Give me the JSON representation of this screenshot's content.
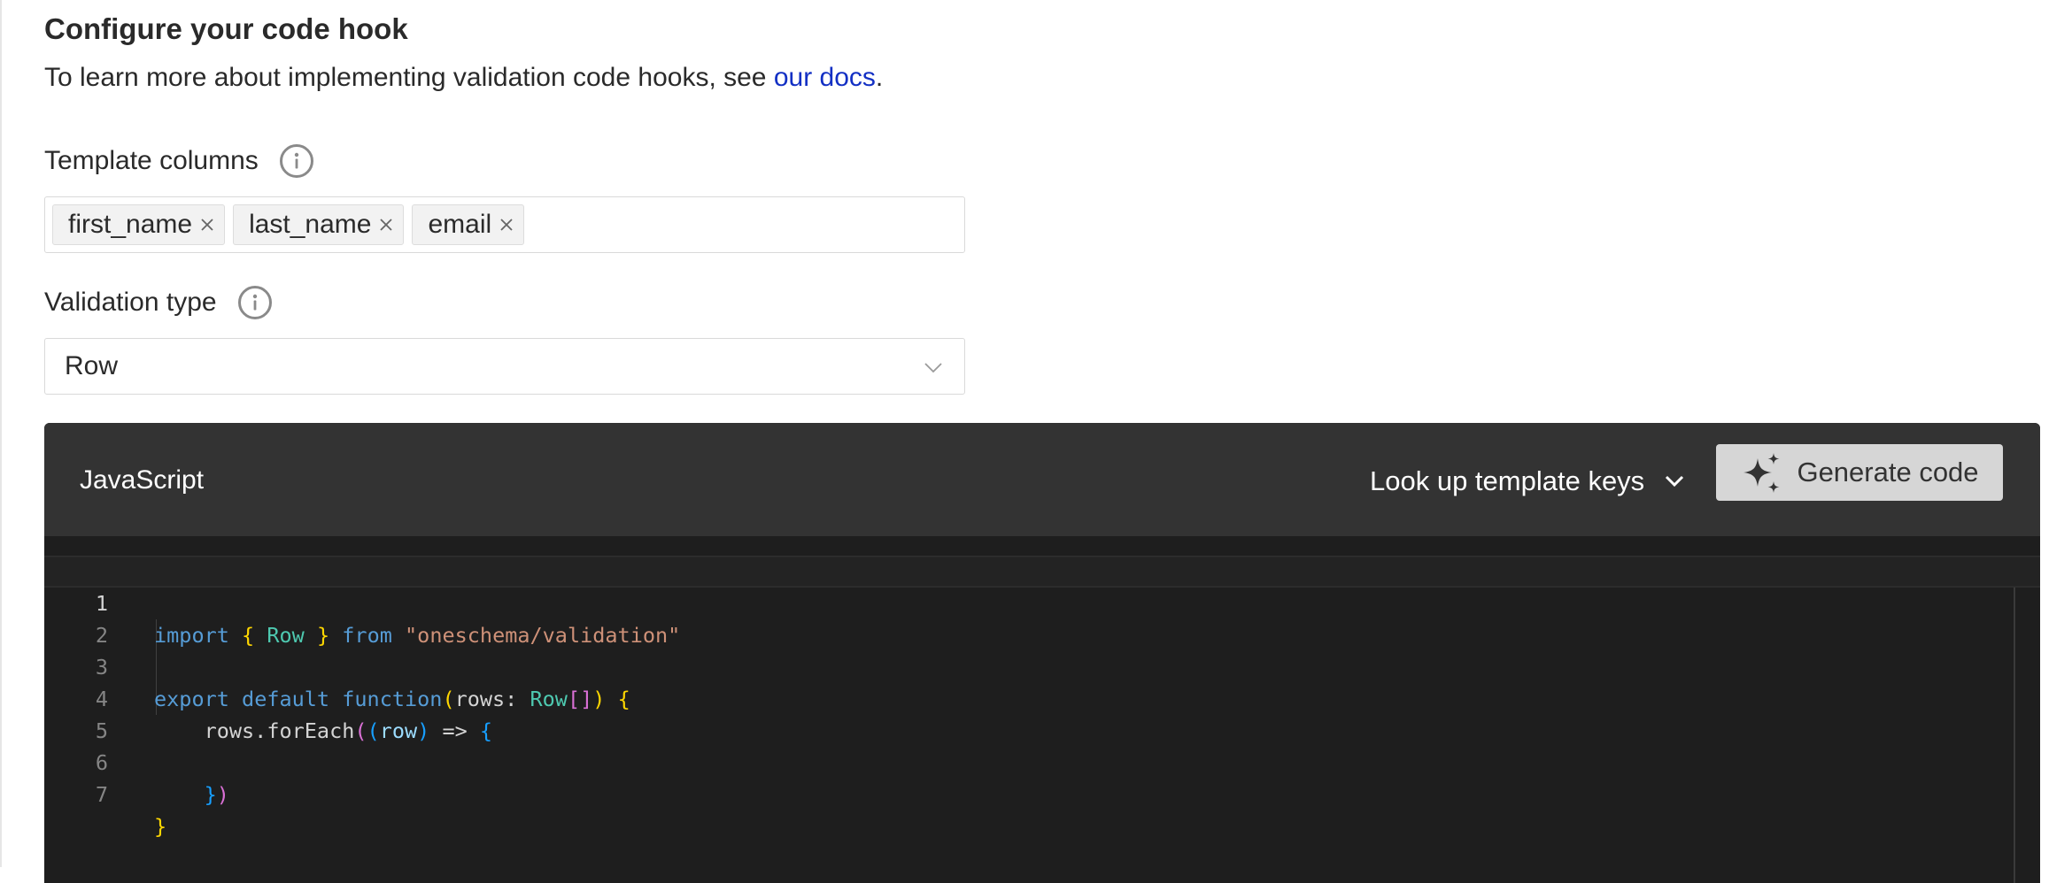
{
  "header": {
    "title": "Configure your code hook",
    "intro_text": "To learn more about implementing validation code hooks, see ",
    "docs_link": "our docs",
    "intro_end": "."
  },
  "template_columns": {
    "label": "Template columns",
    "tags": [
      "first_name",
      "last_name",
      "email"
    ]
  },
  "validation_type": {
    "label": "Validation type",
    "selected": "Row"
  },
  "editor": {
    "language": "JavaScript",
    "lookup_label": "Look up template keys",
    "generate_label": "Generate code",
    "line_numbers": [
      "1",
      "2",
      "3",
      "4",
      "5",
      "6",
      "7"
    ],
    "code": {
      "l1": {
        "import": "import",
        "ob": "{",
        "row": "Row",
        "cb": "}",
        "from": "from",
        "str": "\"oneschema/validation\""
      },
      "l3": {
        "export": "export",
        "default": "default",
        "function": "function",
        "op": "(",
        "rows": "rows:",
        "row": "Row",
        "br": "[]",
        "cp": ")",
        "ob": "{"
      },
      "l4": {
        "call": "rows.forEach",
        "op": "(",
        "ip": "(",
        "row": "row",
        "icp": ")",
        "arrow": "=>",
        "ob": "{"
      },
      "l6": {
        "cb": "}",
        "cp": ")"
      },
      "l7": {
        "cb": "}"
      }
    }
  },
  "icons": {
    "info": "info-circle-icon",
    "remove": "close-icon",
    "dropdown": "chevron-down-icon",
    "sparkle": "sparkle-icon"
  },
  "colors": {
    "link": "#1330c4",
    "editor_bg": "#1e1e1e",
    "editor_header": "#333333",
    "button_bg": "#d6d6d6"
  }
}
